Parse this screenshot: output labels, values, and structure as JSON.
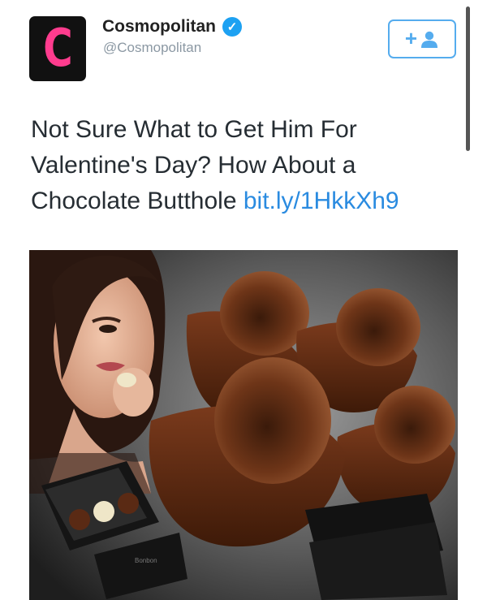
{
  "header": {
    "avatar_letter": "C",
    "display_name": "Cosmopolitan",
    "handle": "@Cosmopolitan"
  },
  "tweet": {
    "text": "Not Sure What to Get Him For Valentine's Day? How About a Chocolate Butthole ",
    "link": "bit.ly/1HkkXh9"
  },
  "photo": {
    "box_label": "Bonbon"
  },
  "colors": {
    "accent": "#55acee",
    "link": "#2a8be0",
    "brand": "#ff3c8e",
    "verified": "#1da1f2"
  }
}
